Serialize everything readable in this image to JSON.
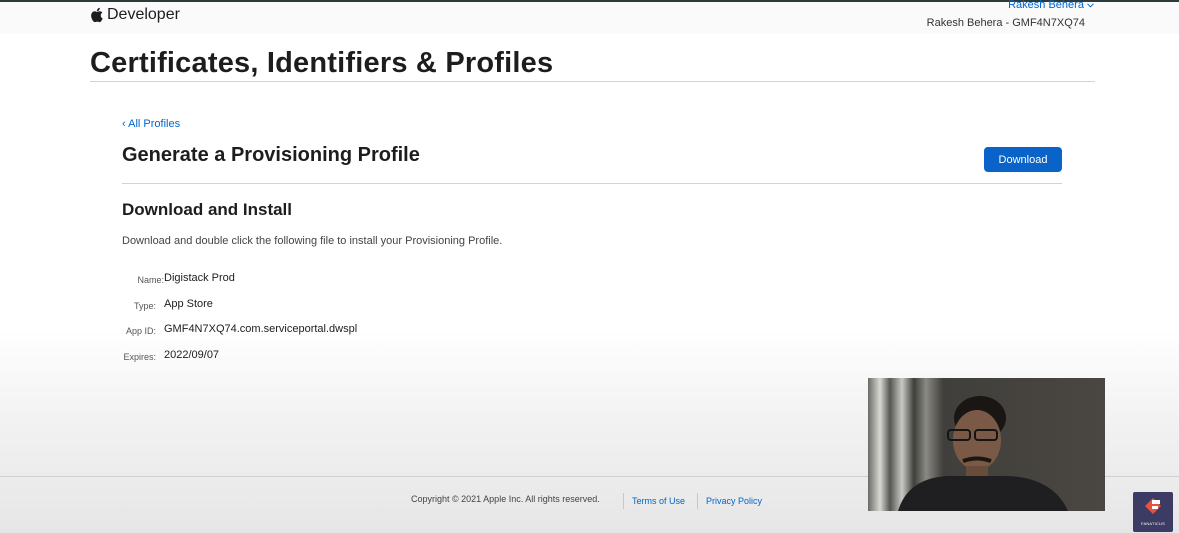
{
  "nav": {
    "brand_label": "Developer",
    "account_name": "Rakesh Behera",
    "account_team": "Rakesh Behera - GMF4N7XQ74"
  },
  "page": {
    "title": "Certificates, Identifiers & Profiles",
    "back_link": "‹ All Profiles",
    "section_title": "Generate a Provisioning Profile",
    "download_button": "Download",
    "sub_title": "Download and Install",
    "description": "Download and double click the following file to install your Provisioning Profile."
  },
  "profile": {
    "name_label": "Name:",
    "name_value": "Digistack Prod",
    "type_label": "Type:",
    "type_value": "App Store",
    "appid_label": "App ID:",
    "appid_value": "GMF4N7XQ74.com.serviceportal.dwspl",
    "expires_label": "Expires:",
    "expires_value": "2022/09/07"
  },
  "footer": {
    "copyright": "Copyright © 2021 Apple Inc. All rights reserved.",
    "terms": "Terms of Use",
    "privacy": "Privacy Policy"
  },
  "overlay": {
    "logo_text": "FANATICUS"
  },
  "colors": {
    "accent": "#0066cc",
    "button": "#0a63c9",
    "logo_bg": "#3b3b63",
    "logo_mark": "#e8533f"
  },
  "icons": [
    "apple-icon",
    "chevron-down-icon",
    "fanaticus-logo-icon"
  ]
}
